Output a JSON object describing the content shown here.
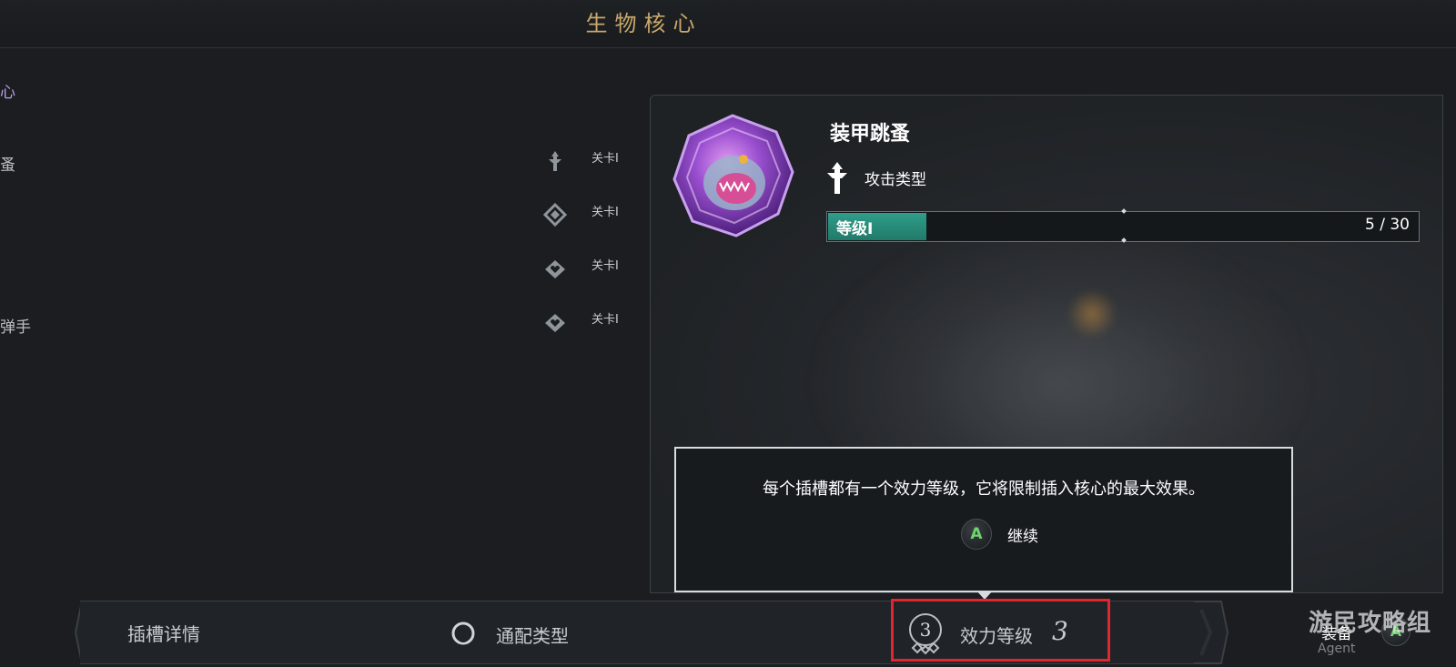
{
  "header": {
    "title": "生物核心"
  },
  "left_list": {
    "items": [
      {
        "label": "心",
        "active": true
      },
      {
        "label": "蚤",
        "active": false
      },
      {
        "label": "弹手",
        "active": false
      }
    ],
    "slots": [
      {
        "icon": "dagger-icon",
        "label": "关卡Ⅰ"
      },
      {
        "icon": "diamond-shield-icon",
        "label": "关卡Ⅰ"
      },
      {
        "icon": "heart-diamond-icon",
        "label": "关卡Ⅰ"
      },
      {
        "icon": "heart-diamond-icon",
        "label": "关卡Ⅰ"
      }
    ]
  },
  "detail": {
    "core_name": "装甲跳蚤",
    "type_icon": "dagger-icon",
    "type_label": "攻击类型",
    "level_label": "等级Ⅰ",
    "level_count": "5 / 30",
    "progress": 0.1667
  },
  "tutorial": {
    "text": "每个插槽都有一个效力等级，它将限制插入核心的最大效果。",
    "button_glyph": "A",
    "continue_label": "继续"
  },
  "bottom_bar": {
    "slot_details_label": "插槽详情",
    "wildcard_icon": "crescent-ring-icon",
    "wildcard_label": "通配类型",
    "potency_icon": "potency-badge-icon",
    "potency_badge_number": "3",
    "potency_label": "效力等级",
    "potency_value": "3",
    "equip_label": "装备",
    "equip_button_glyph": "A"
  },
  "watermark": {
    "text": "游民攻略组",
    "sub": "Agent"
  },
  "colors": {
    "title_gold": "#c9a86a",
    "progress_teal": "#2f9e8a",
    "highlight_red": "#e0262e",
    "active_purple": "#b8a3e6",
    "button_green": "#6ed46e"
  }
}
